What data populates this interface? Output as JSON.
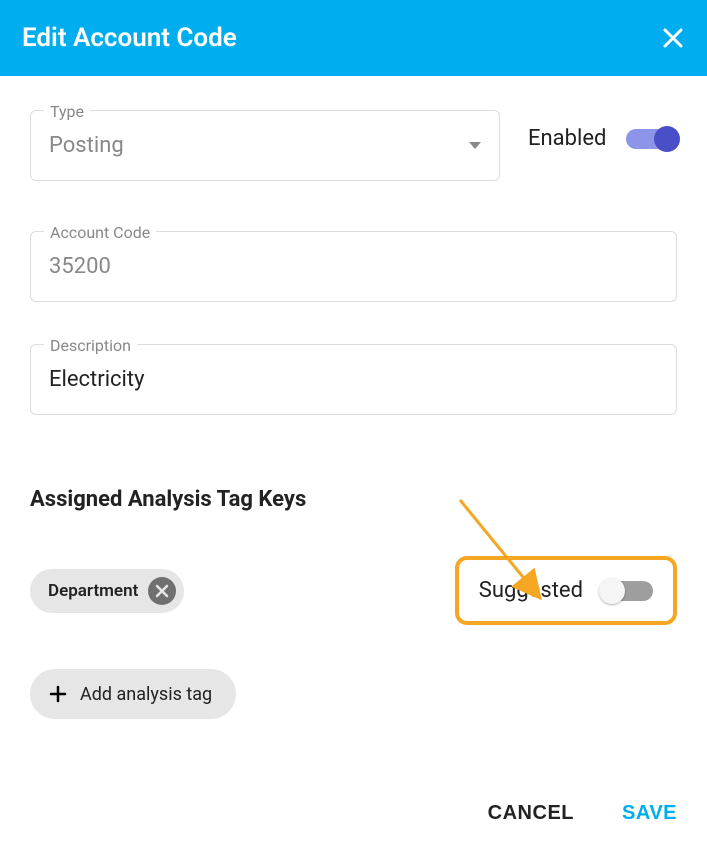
{
  "header": {
    "title": "Edit Account Code",
    "close_icon": "close-icon"
  },
  "fields": {
    "type": {
      "label": "Type",
      "value": "Posting"
    },
    "enabled": {
      "label": "Enabled",
      "state": true
    },
    "account_code": {
      "label": "Account Code",
      "value": "35200"
    },
    "description": {
      "label": "Description",
      "value": "Electricity"
    }
  },
  "section": {
    "title": "Assigned Analysis Tag Keys"
  },
  "tags": [
    {
      "label": "Department"
    }
  ],
  "suggested": {
    "label": "Suggested",
    "state": false
  },
  "add_tag": {
    "label": "Add analysis tag"
  },
  "footer": {
    "cancel": "CANCEL",
    "save": "SAVE"
  },
  "colors": {
    "primary": "#00aeef",
    "toggle_on": "#4b4fc7",
    "highlight": "#f5a623"
  }
}
